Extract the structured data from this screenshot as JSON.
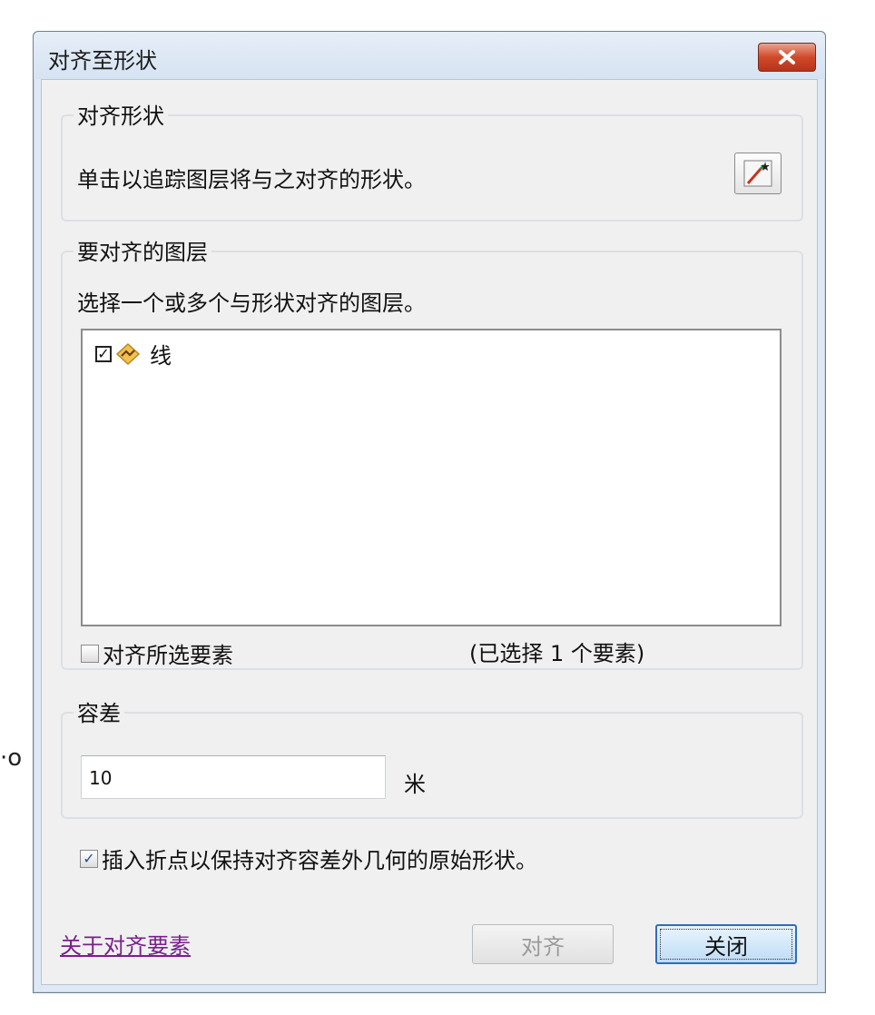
{
  "window": {
    "title": "对齐至形状",
    "close_glyph": "✕"
  },
  "background": {
    "artifact_text": "·o"
  },
  "align_shape": {
    "group_label": "对齐形状",
    "instruction": "单击以追踪图层将与之对齐的形状。"
  },
  "layers": {
    "group_label": "要对齐的图层",
    "instruction": "选择一个或多个与形状对齐的图层。",
    "items": [
      {
        "label": "线",
        "checked": true,
        "icon": "line-layer-icon"
      }
    ],
    "align_selected_label": "对齐所选要素",
    "align_selected_checked": false,
    "selected_count_text": "(已选择 1 个要素)"
  },
  "tolerance": {
    "group_label": "容差",
    "value": "10",
    "unit": "米"
  },
  "insert_vertices": {
    "label": "插入折点以保持对齐容差外几何的原始形状。",
    "checked": true
  },
  "footer": {
    "help_link": "关于对齐要素",
    "align_button": "对齐",
    "close_button": "关闭"
  },
  "colors": {
    "title_bar": "#dbe6f3",
    "close_button": "#cf4a2a",
    "link": "#7a1f8c",
    "default_button_border": "#2e6cc1"
  }
}
